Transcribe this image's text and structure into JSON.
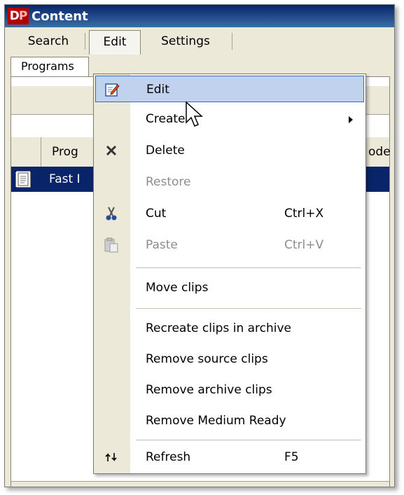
{
  "window": {
    "title": "Content",
    "logo": "DP"
  },
  "menubar": {
    "items": [
      "Search",
      "Edit",
      "Settings"
    ]
  },
  "tabs": {
    "active": "Programs"
  },
  "grid": {
    "column_1": "Prog",
    "column_2": "ode",
    "row_1_text": "Fast I"
  },
  "edit_menu": {
    "items": [
      {
        "label": "Edit",
        "shortcut": "",
        "icon": "edit-icon",
        "disabled": false
      },
      {
        "label": "Create",
        "shortcut": "",
        "icon": "",
        "disabled": false,
        "submenu": true
      },
      {
        "label": "Delete",
        "shortcut": "",
        "icon": "delete-x-icon",
        "disabled": false
      },
      {
        "label": "Restore",
        "shortcut": "",
        "icon": "",
        "disabled": true
      },
      {
        "label": "Cut",
        "shortcut": "Ctrl+X",
        "icon": "cut-icon",
        "disabled": false
      },
      {
        "label": "Paste",
        "shortcut": "Ctrl+V",
        "icon": "paste-icon",
        "disabled": true
      },
      {
        "label": "Move clips",
        "shortcut": "",
        "icon": "",
        "disabled": false
      },
      {
        "label": "Recreate clips in archive",
        "shortcut": "",
        "icon": "",
        "disabled": false
      },
      {
        "label": "Remove source clips",
        "shortcut": "",
        "icon": "",
        "disabled": false
      },
      {
        "label": "Remove archive clips",
        "shortcut": "",
        "icon": "",
        "disabled": false
      },
      {
        "label": "Remove Medium Ready",
        "shortcut": "",
        "icon": "",
        "disabled": false
      },
      {
        "label": "Refresh",
        "shortcut": "F5",
        "icon": "refresh-icon",
        "disabled": false
      }
    ]
  },
  "colors": {
    "title_bar": "#0a246a",
    "highlight": "#c1d2ee",
    "selection_row": "#0a246a",
    "disabled_text": "#8d8d8d"
  }
}
